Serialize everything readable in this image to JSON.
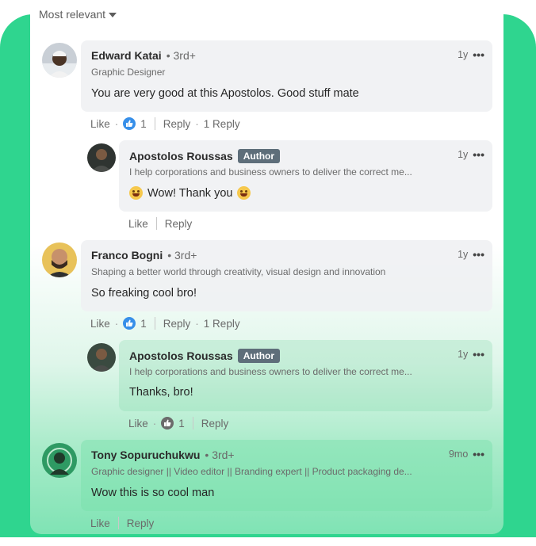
{
  "sort": {
    "label": "Most relevant"
  },
  "comments": [
    {
      "name": "Edward Katai",
      "degree": "• 3rd+",
      "subtitle": "Graphic Designer",
      "text": "You are very good at this Apostolos. Good stuff mate",
      "time": "1y",
      "actions": {
        "like": "Like",
        "reaction_count": "1",
        "reply": "Reply",
        "replies": "1 Reply"
      },
      "reply": {
        "name": "Apostolos Roussas",
        "badge": "Author",
        "subtitle": "I help corporations and business owners to deliver the correct me...",
        "text": "Wow! Thank you",
        "time": "1y",
        "actions": {
          "like": "Like",
          "reply": "Reply"
        }
      }
    },
    {
      "name": "Franco Bogni",
      "degree": "• 3rd+",
      "subtitle": "Shaping a better world through creativity, visual design and innovation",
      "text": "So freaking cool bro!",
      "time": "1y",
      "actions": {
        "like": "Like",
        "reaction_count": "1",
        "reply": "Reply",
        "replies": "1 Reply"
      },
      "reply": {
        "name": "Apostolos Roussas",
        "badge": "Author",
        "subtitle": "I help corporations and business owners to deliver the correct me...",
        "text": "Thanks, bro!",
        "time": "1y",
        "actions": {
          "like": "Like",
          "reaction_count": "1",
          "reply": "Reply"
        }
      }
    },
    {
      "name": "Tony Sopuruchukwu",
      "degree": "• 3rd+",
      "subtitle": "Graphic designer || Video editor || Branding expert || Product packaging de...",
      "text": "Wow this is so cool man",
      "time": "9mo",
      "actions": {
        "like": "Like",
        "reply": "Reply"
      }
    }
  ],
  "colors": {
    "background_green": "#2fd58f",
    "reaction_blue": "#378fe9",
    "author_badge": "#5e6e7a"
  },
  "icons": [
    "caret-down-icon",
    "more-icon",
    "like-reaction-icon",
    "smile-emoji-icon"
  ]
}
